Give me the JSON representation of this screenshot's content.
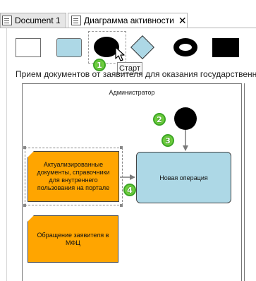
{
  "tabs": [
    {
      "label": "Document 1",
      "active": false
    },
    {
      "label": "Диаграмма активности",
      "active": true,
      "close": "✕"
    }
  ],
  "palette": {
    "items": [
      {
        "name": "rectangle",
        "icon": "rectangle-icon"
      },
      {
        "name": "operation",
        "icon": "rounded-rect-icon"
      },
      {
        "name": "start",
        "icon": "start-ellipse-icon",
        "tooltip": "Старт"
      },
      {
        "name": "decision",
        "icon": "diamond-icon"
      },
      {
        "name": "end",
        "icon": "ring-icon"
      },
      {
        "name": "stop",
        "icon": "black-rect-icon"
      }
    ]
  },
  "badges": {
    "b1": "1",
    "b2": "2",
    "b3": "3",
    "b4": "4"
  },
  "diagram": {
    "pool_title": "Прием документов от заявителя для оказания государственной, м",
    "lane_title": "Администратор",
    "operation_label": "Новая операция",
    "doc1_label": "Актуализированные документы, справочники для внутреннего пользования на портале",
    "doc2_label": "Обращение заявителя в МФЦ"
  },
  "colors": {
    "operation_fill": "#add8e6",
    "document_fill": "#ffa500",
    "badge_fill": "#6fcf3f",
    "start_fill": "#000000"
  }
}
